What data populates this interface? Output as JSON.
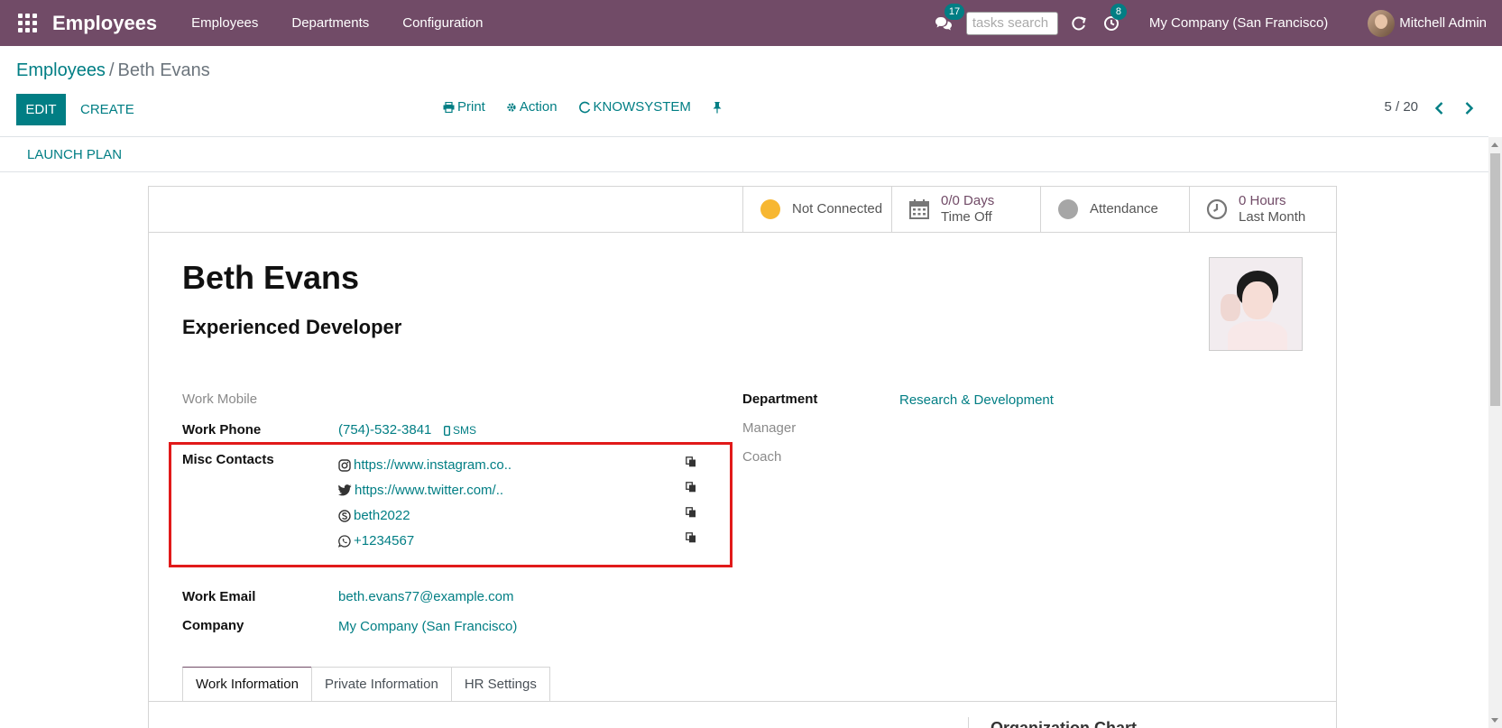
{
  "navbar": {
    "app_title": "Employees",
    "menu": [
      "Employees",
      "Departments",
      "Configuration"
    ],
    "messages_count": "17",
    "activities_count": "8",
    "task_search_placeholder": "tasks search",
    "company": "My Company (San Francisco)",
    "user": "Mitchell Admin"
  },
  "breadcrumb": {
    "parent": "Employees",
    "separator": "/",
    "current": "Beth Evans"
  },
  "control_panel": {
    "edit": "EDIT",
    "create": "CREATE",
    "print": "Print",
    "action": "Action",
    "knowsystem": "KNOWSYSTEM",
    "pager": "5 / 20"
  },
  "statusbar": {
    "launch_plan": "LAUNCH PLAN"
  },
  "stat_buttons": {
    "presence": {
      "label": "Not Connected",
      "color": "#f7b731"
    },
    "time_off": {
      "value": "0/0 Days",
      "label": "Time Off"
    },
    "attendance": {
      "label": "Attendance",
      "color": "#a6a6a6"
    },
    "hours": {
      "value": "0 Hours",
      "label": "Last Month"
    }
  },
  "employee": {
    "name": "Beth Evans",
    "job_title": "Experienced Developer"
  },
  "fields": {
    "work_mobile_label": "Work Mobile",
    "work_phone_label": "Work Phone",
    "work_phone": "(754)-532-3841",
    "sms": "SMS",
    "misc_contacts_label": "Misc Contacts",
    "contacts": [
      {
        "icon": "instagram-icon",
        "value": "https://www.instagram.co.."
      },
      {
        "icon": "twitter-icon",
        "value": "https://www.twitter.com/.."
      },
      {
        "icon": "skype-icon",
        "value": "beth2022"
      },
      {
        "icon": "whatsapp-icon",
        "value": "+1234567"
      }
    ],
    "work_email_label": "Work Email",
    "work_email": "beth.evans77@example.com",
    "company_label": "Company",
    "company": "My Company (San Francisco)",
    "department_label": "Department",
    "department": "Research & Development",
    "manager_label": "Manager",
    "coach_label": "Coach"
  },
  "tabs": [
    "Work Information",
    "Private Information",
    "HR Settings"
  ],
  "org_chart_title": "Organization Chart",
  "colors": {
    "brand": "#714b67",
    "accent": "#017e84",
    "highlight": "#e11a1a"
  }
}
